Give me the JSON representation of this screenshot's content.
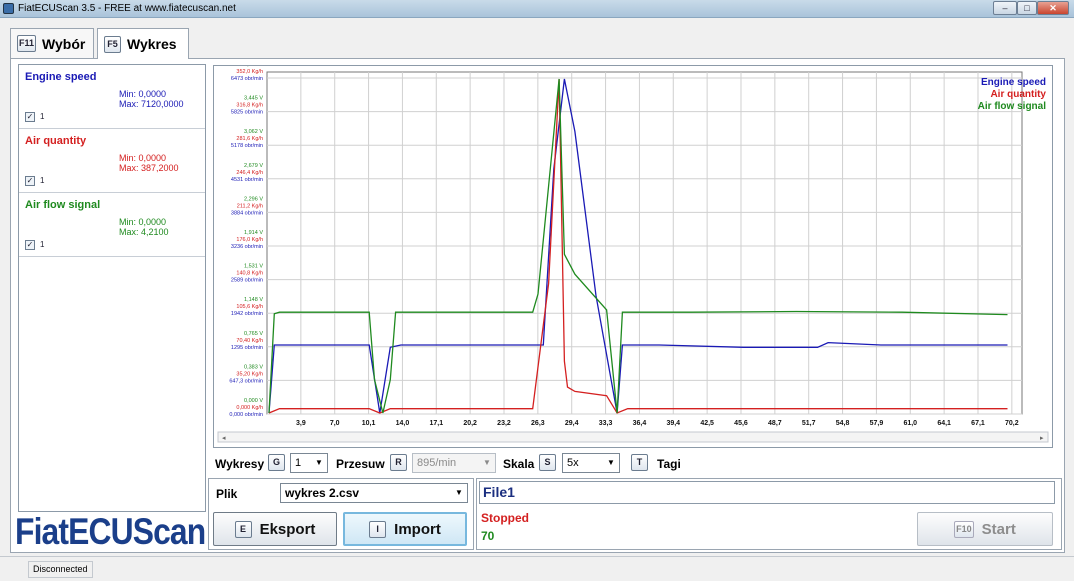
{
  "window": {
    "title": "FiatECUScan 3.5 - FREE at www.fiatecuscan.net",
    "minimize": "–",
    "maximize": "□",
    "close": "✕"
  },
  "tabs": [
    {
      "key": "F11",
      "label": "Wybór"
    },
    {
      "key": "F5",
      "label": "Wykres"
    }
  ],
  "series_panel": [
    {
      "name": "Engine speed",
      "min": "Min: 0,0000",
      "max": "Max: 7120,0000",
      "checked": "✓",
      "check_label": "1",
      "color": "#1a1ab5"
    },
    {
      "name": "Air quantity",
      "min": "Min: 0,0000",
      "max": "Max: 387,2000",
      "checked": "✓",
      "check_label": "1",
      "color": "#d42020"
    },
    {
      "name": "Air flow signal",
      "min": "Min: 0,0000",
      "max": "Max: 4,2100",
      "checked": "✓",
      "check_label": "1",
      "color": "#1f8a1f"
    }
  ],
  "chart_data": {
    "type": "line",
    "legend_placement": "top-right",
    "grid": true,
    "x_ticks": [
      "3,9",
      "7,0",
      "10,1",
      "14,0",
      "17,1",
      "20,2",
      "23,2",
      "26,3",
      "29,4",
      "33,3",
      "36,4",
      "39,4",
      "42,5",
      "45,6",
      "48,7",
      "51,7",
      "54,8",
      "57,9",
      "61,0",
      "64,1",
      "67,1",
      "70,2"
    ],
    "xlim": [
      0,
      71
    ],
    "y_ticks": [
      {
        "v": "0,000 V",
        "a": "0,000 Kg/h",
        "e": "0,000 obr/min"
      },
      {
        "v": "0,383 V",
        "a": "35,20 Kg/h",
        "e": "647,3 obr/min"
      },
      {
        "v": "0,765 V",
        "a": "70,40 Kg/h",
        "e": "1295 obr/min"
      },
      {
        "v": "1,148 V",
        "a": "105,6 Kg/h",
        "e": "1942 obr/min"
      },
      {
        "v": "1,531 V",
        "a": "140,8 Kg/h",
        "e": "2589 obr/min"
      },
      {
        "v": "1,914 V",
        "a": "176,0 Kg/h",
        "e": "3236 obr/min"
      },
      {
        "v": "2,296 V",
        "a": "211,2 Kg/h",
        "e": "3884 obr/min"
      },
      {
        "v": "2,679 V",
        "a": "246,4 Kg/h",
        "e": "4531 obr/min"
      },
      {
        "v": "3,062 V",
        "a": "281,6 Kg/h",
        "e": "5178 obr/min"
      },
      {
        "v": "3,445 V",
        "a": "316,8 Kg/h",
        "e": "5825 obr/min"
      },
      {
        "v": "3,827 V",
        "a": "352,0 Kg/h",
        "e": "6473 obr/min"
      }
    ],
    "series": [
      {
        "name": "Engine speed",
        "color": "#1a1ab5",
        "ymax": 7120,
        "x": [
          0,
          0.5,
          9.5,
          10.5,
          11.5,
          12.5,
          26,
          27,
          28,
          29,
          31,
          33,
          33.5,
          37,
          45,
          52,
          53,
          58,
          70
        ],
        "y": [
          0,
          1450,
          1450,
          0,
          1400,
          1450,
          1450,
          5200,
          7120,
          6000,
          2500,
          0,
          1450,
          1450,
          1400,
          1400,
          1500,
          1450,
          1450
        ]
      },
      {
        "name": "Air quantity",
        "color": "#d42020",
        "ymax": 387.2,
        "x": [
          0,
          1,
          9.5,
          10.5,
          11.5,
          12.5,
          25,
          26.5,
          27.5,
          28,
          28.3,
          29,
          32,
          33,
          34,
          45,
          55,
          60,
          70
        ],
        "y": [
          0,
          5,
          5,
          0,
          5,
          5,
          5,
          150,
          387.2,
          60,
          30,
          25,
          20,
          0,
          5,
          5,
          5,
          5,
          5
        ]
      },
      {
        "name": "Air flow signal",
        "color": "#1f8a1f",
        "ymax": 4.21,
        "x": [
          0,
          0.5,
          1,
          9.5,
          10,
          10.8,
          11.5,
          12,
          25,
          25.5,
          27.5,
          28,
          29,
          32,
          33,
          33.5,
          34,
          40,
          50,
          60,
          70
        ],
        "y": [
          0,
          1.25,
          1.27,
          1.27,
          0.42,
          0,
          0.42,
          1.27,
          1.27,
          1.5,
          4.21,
          2.0,
          1.75,
          1.3,
          0,
          1.27,
          1.27,
          1.27,
          1.28,
          1.27,
          1.24
        ]
      }
    ]
  },
  "controls": {
    "wykresy_label": "Wykresy",
    "wykresy_key": "G",
    "wykresy_value": "1",
    "przesuw_label": "Przesuw",
    "przesuw_key": "R",
    "przesuw_value": "895/min",
    "skala_label": "Skala",
    "skala_key": "S",
    "skala_value": "5x",
    "tagi_key": "T",
    "tagi_label": "Tagi"
  },
  "file": {
    "label": "Plik",
    "selected": "wykres 2.csv",
    "export_key": "E",
    "export_label": "Eksport",
    "import_key": "I",
    "import_label": "Import"
  },
  "status": {
    "file_name": "File1",
    "state": "Stopped",
    "count": "70",
    "start_key": "F10",
    "start_label": "Start"
  },
  "logo": "FiatECUScan",
  "statusbar": {
    "connection": "Disconnected"
  }
}
